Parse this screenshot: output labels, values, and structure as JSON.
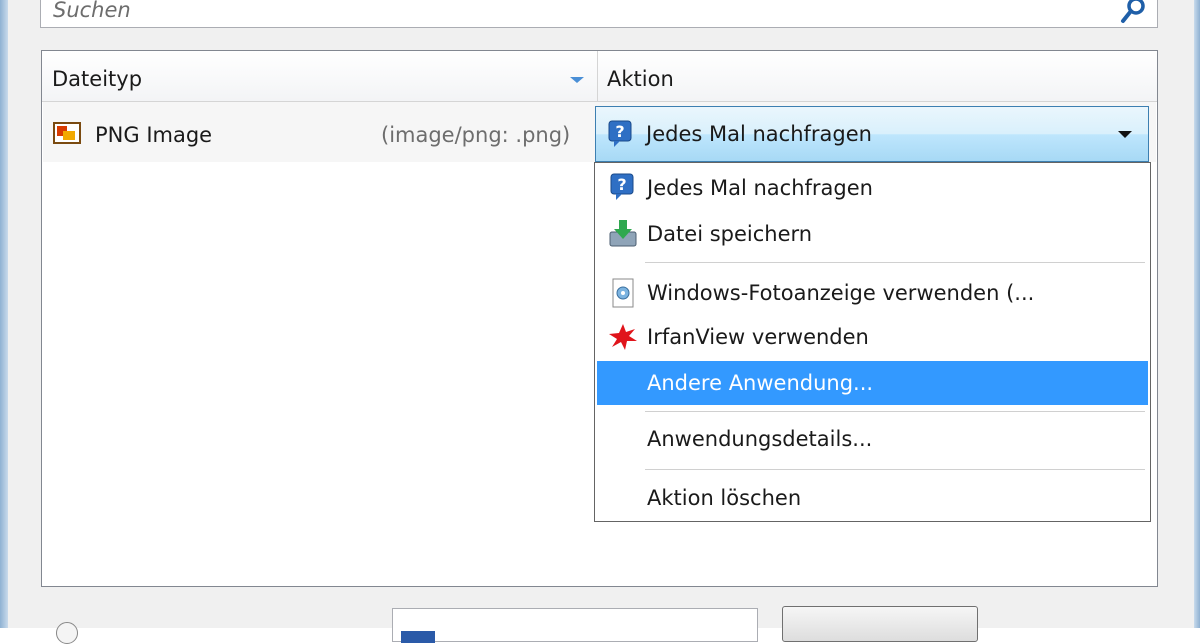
{
  "search": {
    "placeholder": "Suchen",
    "icon": "search-icon"
  },
  "table": {
    "columns": [
      "Dateityp",
      "Aktion"
    ],
    "rows": [
      {
        "type": "PNG Image",
        "mime": "(image/png: .png)",
        "icon": "png-file-icon",
        "action": "Jedes Mal nachfragen",
        "action_icon": "question-icon"
      }
    ]
  },
  "dropdown": {
    "items": [
      {
        "label": "Jedes Mal nachfragen",
        "icon": "question-icon"
      },
      {
        "label": "Datei speichern",
        "icon": "save-download-icon"
      },
      {
        "label": "Windows-Fotoanzeige verwenden (...",
        "icon": "photo-viewer-icon"
      },
      {
        "label": "IrfanView verwenden",
        "icon": "irfanview-icon"
      },
      {
        "label": "Andere Anwendung...",
        "icon": "",
        "selected": true
      },
      {
        "label": "Anwendungsdetails...",
        "icon": ""
      },
      {
        "label": "Aktion löschen",
        "icon": ""
      }
    ]
  },
  "colors": {
    "selection": "#3399ff",
    "combo_border": "#3c7fb1"
  }
}
